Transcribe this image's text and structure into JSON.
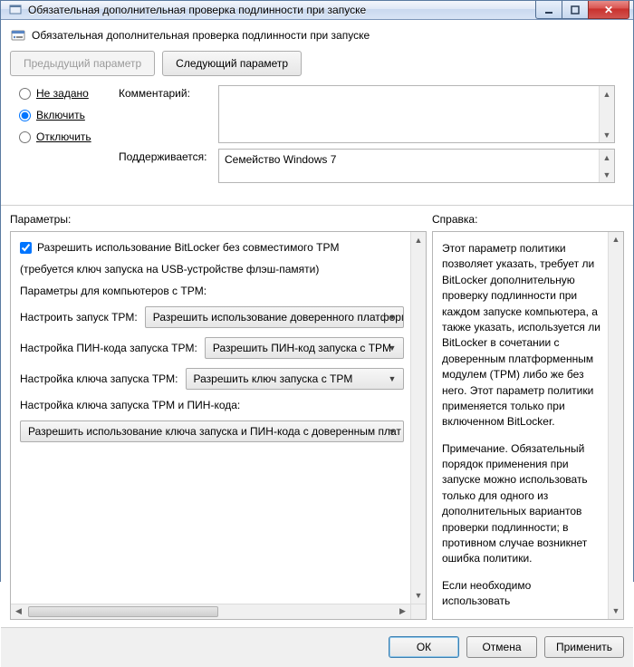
{
  "window": {
    "title": "Обязательная дополнительная проверка подлинности при запуске"
  },
  "header": {
    "title": "Обязательная дополнительная проверка подлинности при запуске"
  },
  "nav": {
    "prev": "Предыдущий параметр",
    "next": "Следующий параметр"
  },
  "state": {
    "not_configured": "Не задано",
    "enabled": "Включить",
    "disabled": "Отключить",
    "selected": "enabled"
  },
  "form": {
    "comment_label": "Комментарий:",
    "comment_value": "",
    "supported_label": "Поддерживается:",
    "supported_value": "Семейство Windows 7"
  },
  "panels": {
    "params_title": "Параметры:",
    "help_title": "Справка:"
  },
  "params": {
    "allow_no_tpm_label": "Разрешить использование BitLocker без совместимого TPM",
    "allow_no_tpm_checked": true,
    "usb_note": "(требуется ключ запуска на USB-устройстве флэш-памяти)",
    "tpm_section": "Параметры для компьютеров с TPM:",
    "configure_tpm_startup_label": "Настроить запуск TPM:",
    "configure_tpm_startup_value": "Разрешить использование доверенного платформ",
    "pin_label": "Настройка ПИН-кода запуска TPM:",
    "pin_value": "Разрешить ПИН-код запуска с TPM",
    "key_label": "Настройка ключа запуска TPM:",
    "key_value": "Разрешить ключ запуска с TPM",
    "keypin_label": "Настройка ключа запуска TPM и ПИН-кода:",
    "keypin_value": "Разрешить использование ключа запуска и ПИН-кода с доверенным плат"
  },
  "help": {
    "p1": "Этот параметр политики позволяет указать, требует ли BitLocker дополнительную проверку подлинности при каждом запуске компьютера, а также указать, используется ли BitLocker в сочетании с доверенным платформенным модулем (TPM) либо же без него. Этот параметр политики применяется только при включенном BitLocker.",
    "p2": "Примечание. Обязательный порядок применения при запуске можно использовать только для одного из дополнительных вариантов проверки подлинности; в противном случае возникнет ошибка политики.",
    "p3": "Если необходимо использовать"
  },
  "footer": {
    "ok": "ОК",
    "cancel": "Отмена",
    "apply": "Применить"
  }
}
